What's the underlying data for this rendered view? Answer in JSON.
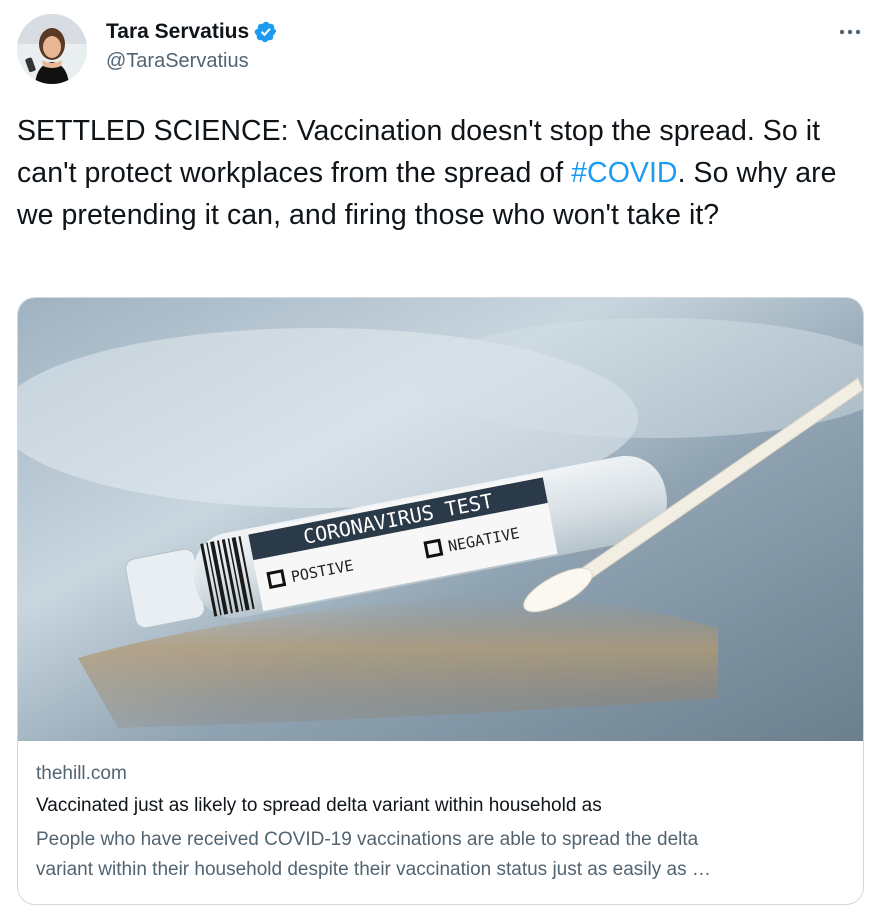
{
  "author": {
    "display_name": "Tara Servatius",
    "handle": "@TaraServatius",
    "verified": true
  },
  "tweet": {
    "text_before": "SETTLED SCIENCE: Vaccination doesn't stop the spread. So it can't protect workplaces from the spread of ",
    "hashtag": "#COVID",
    "text_after": ". So why are we pretending it can, and firing those who won't take it?"
  },
  "card": {
    "image_text": {
      "heading": "CORONAVIRUS TEST",
      "option_a": "POSTIVE",
      "option_b": "NEGATIVE"
    },
    "domain": "thehill.com",
    "title": "Vaccinated just as likely to spread delta variant within household as",
    "description_line1": "People who have received COVID-19 vaccinations are able to spread the delta",
    "description_line2": "variant within their household despite their vaccination status just as easily as …"
  },
  "icons": [
    "verified-badge-icon",
    "more-options-icon"
  ],
  "colors": {
    "link": "#1d9bf0",
    "secondary_text": "#536471",
    "primary_text": "#0f1419",
    "border": "#cfd9de"
  }
}
